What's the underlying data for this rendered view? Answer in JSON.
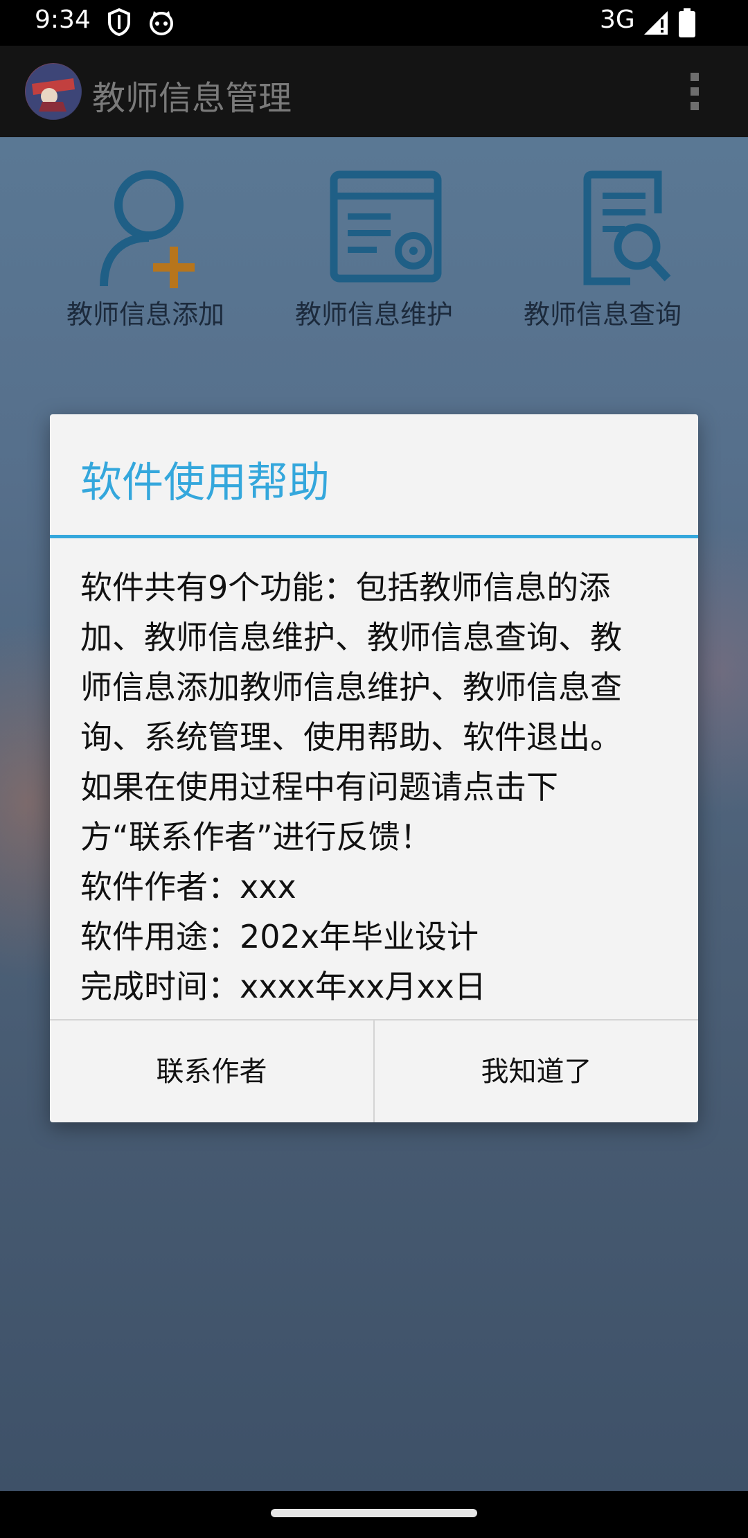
{
  "status_bar": {
    "time": "9:34",
    "left_icons": [
      "shield-icon",
      "cat-face-icon"
    ],
    "network": "3G",
    "right_icons": [
      "signal-icon",
      "battery-icon"
    ]
  },
  "app_bar": {
    "title": "教师信息管理",
    "logo_icon": "app-avatar-icon",
    "menu_icon": "overflow-menu-icon"
  },
  "features": [
    {
      "label": "教师信息添加",
      "icon": "add-user-icon"
    },
    {
      "label": "教师信息维护",
      "icon": "document-gear-icon"
    },
    {
      "label": "教师信息查询",
      "icon": "document-search-icon"
    }
  ],
  "dialog": {
    "title": "软件使用帮助",
    "body_lines": [
      "软件共有9个功能：包括教师信息的添",
      "加、教师信息维护、教师信息查询、教",
      "师信息添加教师信息维护、教师信息查",
      "询、系统管理、使用帮助、软件退出。",
      "如果在使用过程中有问题请点击下",
      "方“联系作者”进行反馈！",
      "软件作者：xxx",
      "软件用途：202x年毕业设计",
      "完成时间：xxxx年xx月xx日"
    ],
    "buttons": {
      "contact": "联系作者",
      "ok": "我知道了"
    }
  },
  "colors": {
    "accent": "#34a7dc",
    "icon_blue": "#1f5f86",
    "icon_orange": "#b7751c"
  }
}
